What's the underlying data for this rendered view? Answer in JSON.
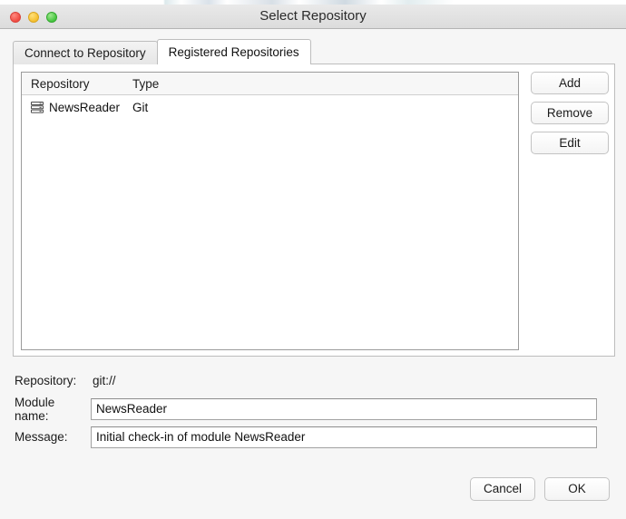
{
  "window": {
    "title": "Select Repository",
    "traffic_lights": [
      {
        "name": "close",
        "color": "#f04b42"
      },
      {
        "name": "minimize",
        "color": "#f5bf2e"
      },
      {
        "name": "maximize",
        "color": "#45c53f"
      }
    ]
  },
  "tabs": [
    {
      "label": "Connect to Repository",
      "active": false
    },
    {
      "label": "Registered Repositories",
      "active": true
    }
  ],
  "list": {
    "columns": [
      "Repository",
      "Type"
    ],
    "rows": [
      {
        "icon": "server-stack-icon",
        "repository": "NewsReader",
        "type": "Git"
      }
    ]
  },
  "side_buttons": [
    {
      "label": "Add"
    },
    {
      "label": "Remove"
    },
    {
      "label": "Edit"
    }
  ],
  "form": {
    "repository": {
      "label": "Repository:",
      "value": "git://"
    },
    "module_name": {
      "label": "Module name:",
      "value": "NewsReader",
      "placeholder": ""
    },
    "message": {
      "label": "Message:",
      "value": "Initial check-in of module NewsReader",
      "placeholder": ""
    }
  },
  "footer": {
    "cancel_label": "Cancel",
    "ok_label": "OK"
  }
}
